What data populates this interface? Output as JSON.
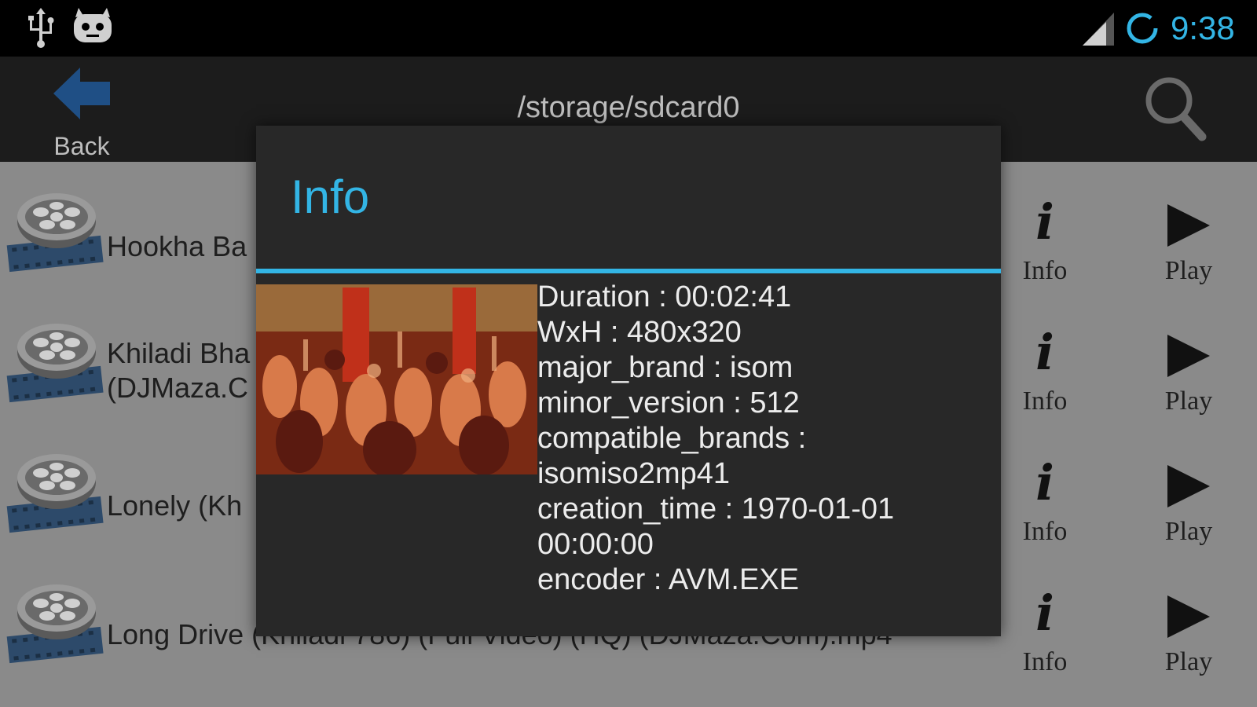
{
  "status_bar": {
    "time": "9:38",
    "accent_color": "#33b5e5",
    "icons": [
      "usb-icon",
      "cyanogen-icon",
      "signal-icon",
      "sync-icon"
    ]
  },
  "action_bar": {
    "back_label": "Back",
    "path": "/storage/sdcard0",
    "search_icon": "search-icon"
  },
  "files": [
    {
      "name_lines": [
        "Hookha Ba"
      ]
    },
    {
      "name_lines": [
        "Khiladi Bha",
        "(DJMaza.C"
      ]
    },
    {
      "name_lines": [
        "Lonely (Kh"
      ]
    },
    {
      "name_lines": [
        "Long Drive (Khiladi 786) (Full Video) (HQ) (DJMaza.Com).mp4"
      ]
    }
  ],
  "row_actions": {
    "info_glyph": "i",
    "info_label": "Info",
    "play_label": "Play"
  },
  "dialog": {
    "title": "Info",
    "metadata_lines": [
      "Duration : 00:02:41",
      "WxH : 480x320",
      "major_brand : isom",
      "minor_version : 512",
      "compatible_brands :",
      "isomiso2mp41",
      "creation_time : 1970-01-01",
      "00:00:00",
      "encoder : AVM.EXE"
    ]
  }
}
